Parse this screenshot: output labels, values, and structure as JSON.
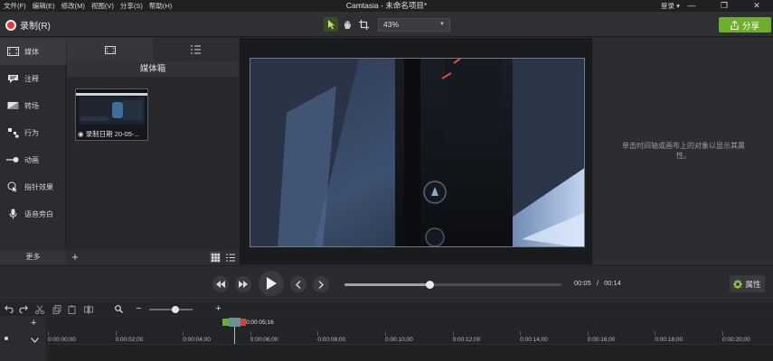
{
  "menu": [
    "文件(F)",
    "编辑(E)",
    "修改(M)",
    "视图(V)",
    "分享(S)",
    "帮助(H)"
  ],
  "app_title": "Camtasia - 未命名项目*",
  "login": "登录 ▾",
  "window_controls": [
    "—",
    "❐",
    "✕"
  ],
  "toolbar": {
    "record_label": "录制(R)",
    "zoom_value": "43%",
    "share_label": "分享"
  },
  "rail": {
    "items": [
      {
        "label": "媒体",
        "icon": "media-icon"
      },
      {
        "label": "注释",
        "icon": "annotation-icon"
      },
      {
        "label": "转场",
        "icon": "transition-icon"
      },
      {
        "label": "行为",
        "icon": "behavior-icon"
      },
      {
        "label": "动画",
        "icon": "animation-icon"
      },
      {
        "label": "指针效果",
        "icon": "cursor-effect-icon"
      },
      {
        "label": "语音旁白",
        "icon": "voice-narration-icon"
      }
    ],
    "more_label": "更多"
  },
  "bin": {
    "title": "媒体箱",
    "clip_label": "◉ 录制日期 20-05-..."
  },
  "props": {
    "hint": "单击时间轴或画布上的对象以显示其属性。"
  },
  "playback": {
    "current_time": "00:05",
    "separator": "/",
    "total_time": "00:14",
    "progress": 0.39,
    "props_label": "属性"
  },
  "timeline": {
    "zoom_level": 0.6,
    "playhead_time": "0:00:05;16",
    "ticks": [
      "0:00:00;00",
      "0:00:02;00",
      "0:00:04;00",
      "0:00:06;00",
      "0:00:08;00",
      "0:00:10;00",
      "0:00:12;00",
      "0:00:14;00",
      "0:00:16;00",
      "0:00:18;00",
      "0:00:20;00"
    ]
  },
  "colors": {
    "accent_green": "#6dae2c",
    "record_red": "#e53935"
  }
}
